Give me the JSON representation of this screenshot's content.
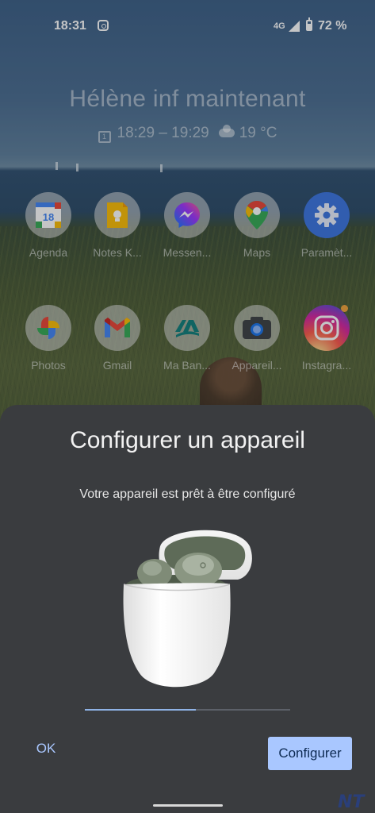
{
  "status_bar": {
    "time": "18:31",
    "network": "4G",
    "battery": "72 %",
    "notification_icons": [
      "instagram-icon"
    ]
  },
  "widget": {
    "event_title": "Hélène inf maintenant",
    "event_time": "18:29 – 19:29",
    "weather": "19 °C",
    "calendar_day": "1"
  },
  "apps": [
    {
      "label": "Agenda",
      "icon": "google-calendar-icon"
    },
    {
      "label": "Notes K...",
      "icon": "google-keep-icon"
    },
    {
      "label": "Messen...",
      "icon": "messenger-icon"
    },
    {
      "label": "Maps",
      "icon": "google-maps-icon"
    },
    {
      "label": "Paramèt...",
      "icon": "settings-icon"
    },
    {
      "label": "Photos",
      "icon": "google-photos-icon"
    },
    {
      "label": "Gmail",
      "icon": "gmail-icon"
    },
    {
      "label": "Ma Ban...",
      "icon": "credit-agricole-icon"
    },
    {
      "label": "Appareil...",
      "icon": "camera-icon"
    },
    {
      "label": "Instagra...",
      "icon": "instagram-icon"
    }
  ],
  "calendar_icon_day": "18",
  "dialog": {
    "title": "Configurer un appareil",
    "subtitle": "Votre appareil est prêt à être configuré",
    "progress": 0.54,
    "ok_label": "OK",
    "configure_label": "Configurer"
  },
  "watermark": "NT",
  "colors": {
    "accent": "#a9c7ff",
    "sheet_bg": "#3a3c3f",
    "button_text": "#0d2a52"
  }
}
